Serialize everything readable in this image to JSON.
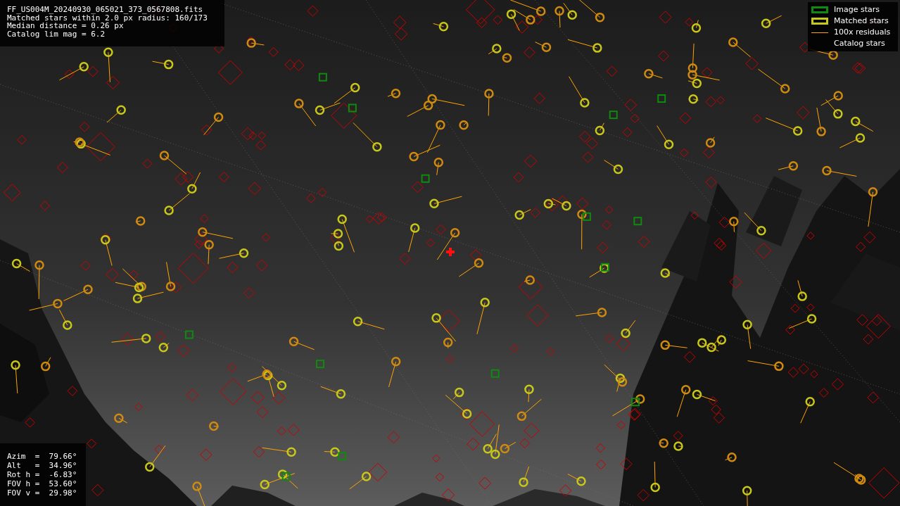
{
  "info": {
    "lines": [
      "FF_US004M_20240930_065021_373_0567808.fits",
      "Matched stars within 2.0 px radius: 160/173",
      "Median distance = 0.26 px",
      "Catalog lim mag = 6.2"
    ]
  },
  "legend": {
    "items": [
      {
        "label": "Image stars",
        "kind": "box",
        "color": "#0f8a0f"
      },
      {
        "label": "Matched stars",
        "kind": "box",
        "color": "#c8c81a"
      },
      {
        "label": "100x residuals",
        "kind": "line",
        "color": "#ffa500"
      },
      {
        "label": "Catalog stars",
        "kind": "blank"
      }
    ]
  },
  "pointing": {
    "rows": [
      "Azim  =  79.66°",
      "Alt   =  34.96°",
      "Rot h =  -6.83°",
      "FOV h =  53.60°",
      "FOV v =  29.98°"
    ]
  }
}
